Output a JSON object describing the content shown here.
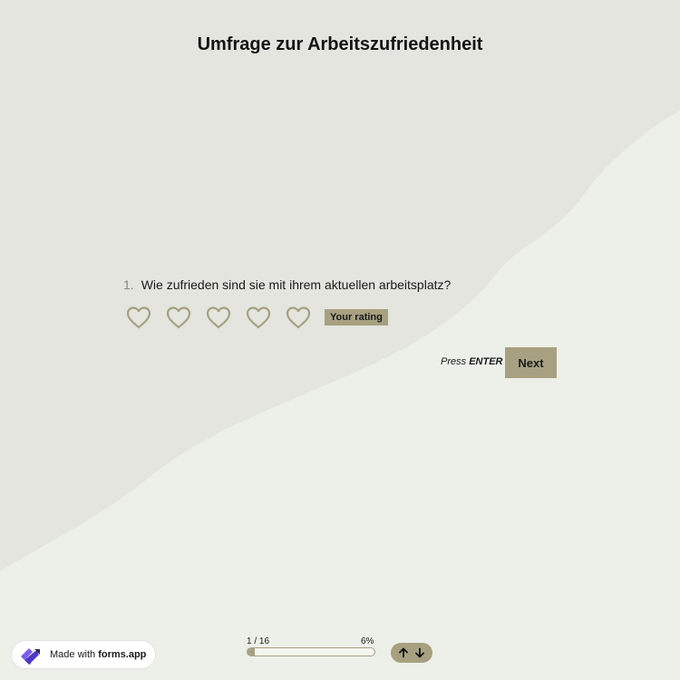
{
  "title": "Umfrage zur Arbeitszufriedenheit",
  "question": {
    "number": "1.",
    "text": "Wie zufrieden sind sie mit ihrem aktuellen arbeitsplatz?",
    "rating_max": 5,
    "rating_value": 0,
    "rating_badge": "Your rating"
  },
  "actions": {
    "press_prefix": "Press",
    "press_key": "ENTER",
    "next_label": "Next"
  },
  "progress": {
    "counter": "1 / 16",
    "percent_label": "6%",
    "fraction": 0.06
  },
  "badge": {
    "prefix": "Made with",
    "brand": "forms.app"
  },
  "colors": {
    "accent": "#a7a181",
    "background": "#edefe9",
    "shadow_shape": "#e3e5de"
  },
  "icons": {
    "rating": "heart-outline-icon",
    "logo": "forms-app-logo-icon",
    "up": "arrow-up-icon",
    "down": "arrow-down-icon"
  }
}
